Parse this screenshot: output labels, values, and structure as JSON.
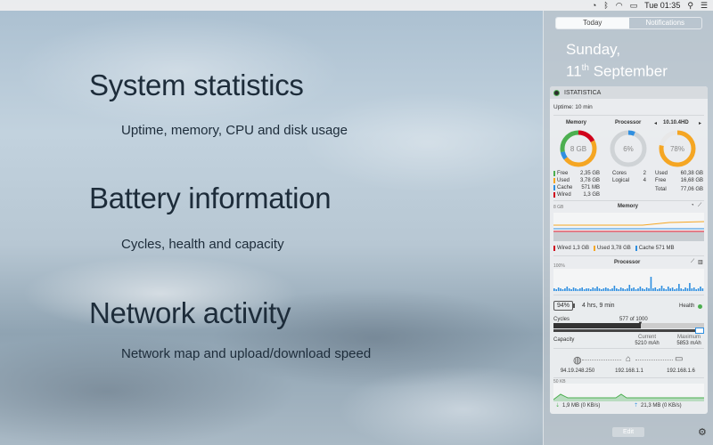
{
  "menubar": {
    "apple_icon": "apple-icon",
    "time": "Tue 01:35",
    "icons": [
      "activity-icon",
      "bluetooth-icon",
      "wifi-icon",
      "battery-icon",
      "spotlight-icon",
      "notification-list-icon"
    ]
  },
  "slide": {
    "sections": [
      {
        "title": "System statistics",
        "subtitle": "Uptime, memory, CPU and disk usage"
      },
      {
        "title": "Battery information",
        "subtitle": "Cycles, health and capacity"
      },
      {
        "title": "Network activity",
        "subtitle": "Network map and upload/download speed"
      }
    ]
  },
  "nc": {
    "tabs": [
      "Today",
      "Notifications"
    ],
    "date_line1": "Sunday,",
    "date_day": "11",
    "date_suffix": "th",
    "date_month": " September",
    "edit_label": "Edit"
  },
  "widget": {
    "title": "ISTATISTICA",
    "uptime": "Uptime: 10 min",
    "memory_title": "Memory",
    "processor_title": "Processor",
    "disk_title": "10.10.4HD",
    "memory_center": "8 GB",
    "processor_center": "6%",
    "disk_center": "78%",
    "memory_stats": [
      {
        "label": "Free",
        "value": "2,35 GB",
        "color": "#4caf50"
      },
      {
        "label": "Used",
        "value": "3,78 GB",
        "color": "#f5a623"
      },
      {
        "label": "Cache",
        "value": "571 MB",
        "color": "#2f8fe0"
      },
      {
        "label": "Wired",
        "value": "1,3 GB",
        "color": "#d0021b"
      }
    ],
    "processor_stats": [
      {
        "label": "Cores",
        "value": "2"
      },
      {
        "label": "Logical",
        "value": "4"
      }
    ],
    "disk_stats": [
      {
        "label": "Used",
        "value": "60,38 GB"
      },
      {
        "label": "Free",
        "value": "16,68 GB"
      },
      {
        "label": "Total",
        "value": "77,06 GB"
      }
    ],
    "mem_graph_title": "Memory",
    "mem_graph_scale": "8 GB",
    "mem_legend": [
      {
        "label": "Wired",
        "value": "1,3 GB",
        "color": "#d0021b"
      },
      {
        "label": "Used",
        "value": "3,78 GB",
        "color": "#f5a623"
      },
      {
        "label": "Cache",
        "value": "571 MB",
        "color": "#2f8fe0"
      }
    ],
    "cpu_graph_title": "Processor",
    "cpu_graph_scale": "100%",
    "battery_percent": "94%",
    "battery_time": "4 hrs, 9 min",
    "health_label": "Health",
    "cycles_label": "Cycles",
    "cycles_value": "577 of 1000",
    "cycles_fraction": 0.577,
    "capacity_label": "Capacity",
    "current_label": "Current",
    "current_value": "5210 mAh",
    "maximum_label": "Maximum",
    "maximum_value": "5853 mAh",
    "net_nodes": [
      {
        "icon": "globe-icon",
        "ip": "94.19.248.250"
      },
      {
        "icon": "router-icon",
        "ip": "192.168.1.1"
      },
      {
        "icon": "laptop-icon",
        "ip": "192.168.1.6"
      }
    ],
    "net_scale": "50 KB",
    "download": "1,9 MB (0 KB/s)",
    "upload": "21,3 MB (0 KB/s)"
  }
}
